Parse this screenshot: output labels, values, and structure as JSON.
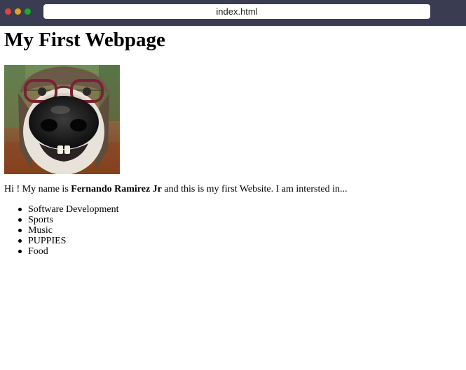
{
  "browser": {
    "url": "index.html"
  },
  "page": {
    "title": "My First Webpage",
    "photo_alt": "puppy wearing glasses and hat",
    "intro": {
      "before": "Hi ! My name is ",
      "name": "Fernando Ramirez Jr",
      "after": " and this is my first Website. I am intersted in..."
    },
    "interests": [
      "Software Development",
      "Sports",
      "Music",
      "PUPPIES",
      "Food"
    ]
  }
}
